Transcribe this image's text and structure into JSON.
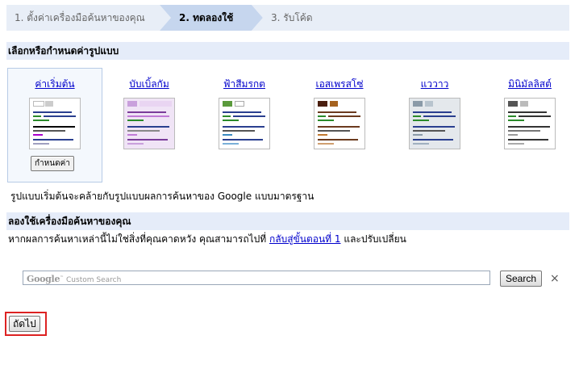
{
  "wizard": {
    "steps": [
      {
        "label": "1. ตั้งค่าเครื่องมือค้นหาของคุณ",
        "state": "done"
      },
      {
        "label": "2. ทดลองใช้",
        "state": "current"
      },
      {
        "label": "3. รับโค้ด",
        "state": "upcoming"
      }
    ]
  },
  "themes_section": {
    "title": "เลือกหรือกำหนดค่ารูปแบบ",
    "themes": [
      {
        "label": "ค่าเริ่มต้น",
        "accent": "#ffffff",
        "selected": true
      },
      {
        "label": "บับเบิ้ลกัม",
        "accent": "#c9a0dc",
        "selected": false
      },
      {
        "label": "ฟ้าสีมรกต",
        "accent": "#5a9a3c",
        "selected": false
      },
      {
        "label": "เอสเพรสโซ่",
        "accent": "#6b3a1e",
        "selected": false
      },
      {
        "label": "แววาว",
        "accent": "#8a9aa8",
        "selected": false
      },
      {
        "label": "มินิมัลลิสต์",
        "accent": "#555555",
        "selected": false
      }
    ],
    "customize_label": "กำหนดค่า",
    "description": "รูปแบบเริ่มต้นจะคล้ายกับรูปแบบผลการค้นหาของ Google แบบมาตรฐาน"
  },
  "try_section": {
    "title": "ลองใช้เครื่องมือค้นหาของคุณ",
    "text_before": "หากผลการค้นหาเหล่านี้ไม่ใช่สิ่งที่คุณคาดหวัง คุณสามารถไปที่ ",
    "link": "กลับสู่ขั้นตอนที่ 1",
    "text_after": " และปรับเปลี่ยน"
  },
  "search_box": {
    "brand": "Google",
    "tm": "™",
    "placeholder": "Custom Search",
    "button": "Search",
    "clear": "×"
  },
  "next_button": "ถัดไป"
}
